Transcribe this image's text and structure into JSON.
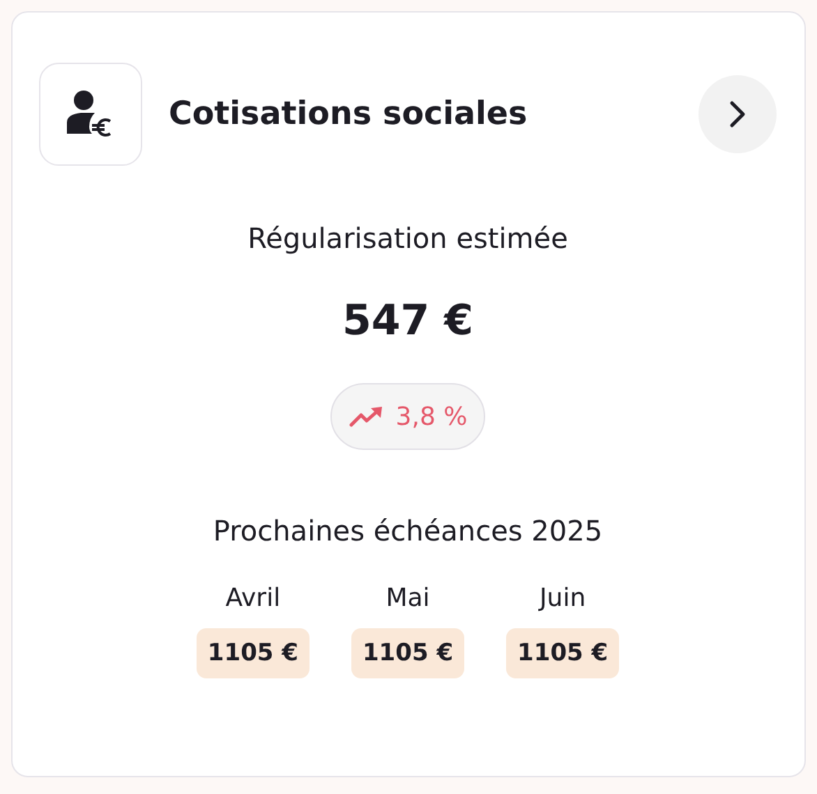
{
  "card": {
    "title": "Cotisations sociales",
    "subtitle": "Régularisation estimée",
    "amount": "547 €",
    "trend": "3,8 %",
    "schedule_title": "Prochaines échéances 2025",
    "schedule": [
      {
        "month": "Avril",
        "amount": "1105 €"
      },
      {
        "month": "Mai",
        "amount": "1105 €"
      },
      {
        "month": "Juin",
        "amount": "1105 €"
      }
    ]
  }
}
